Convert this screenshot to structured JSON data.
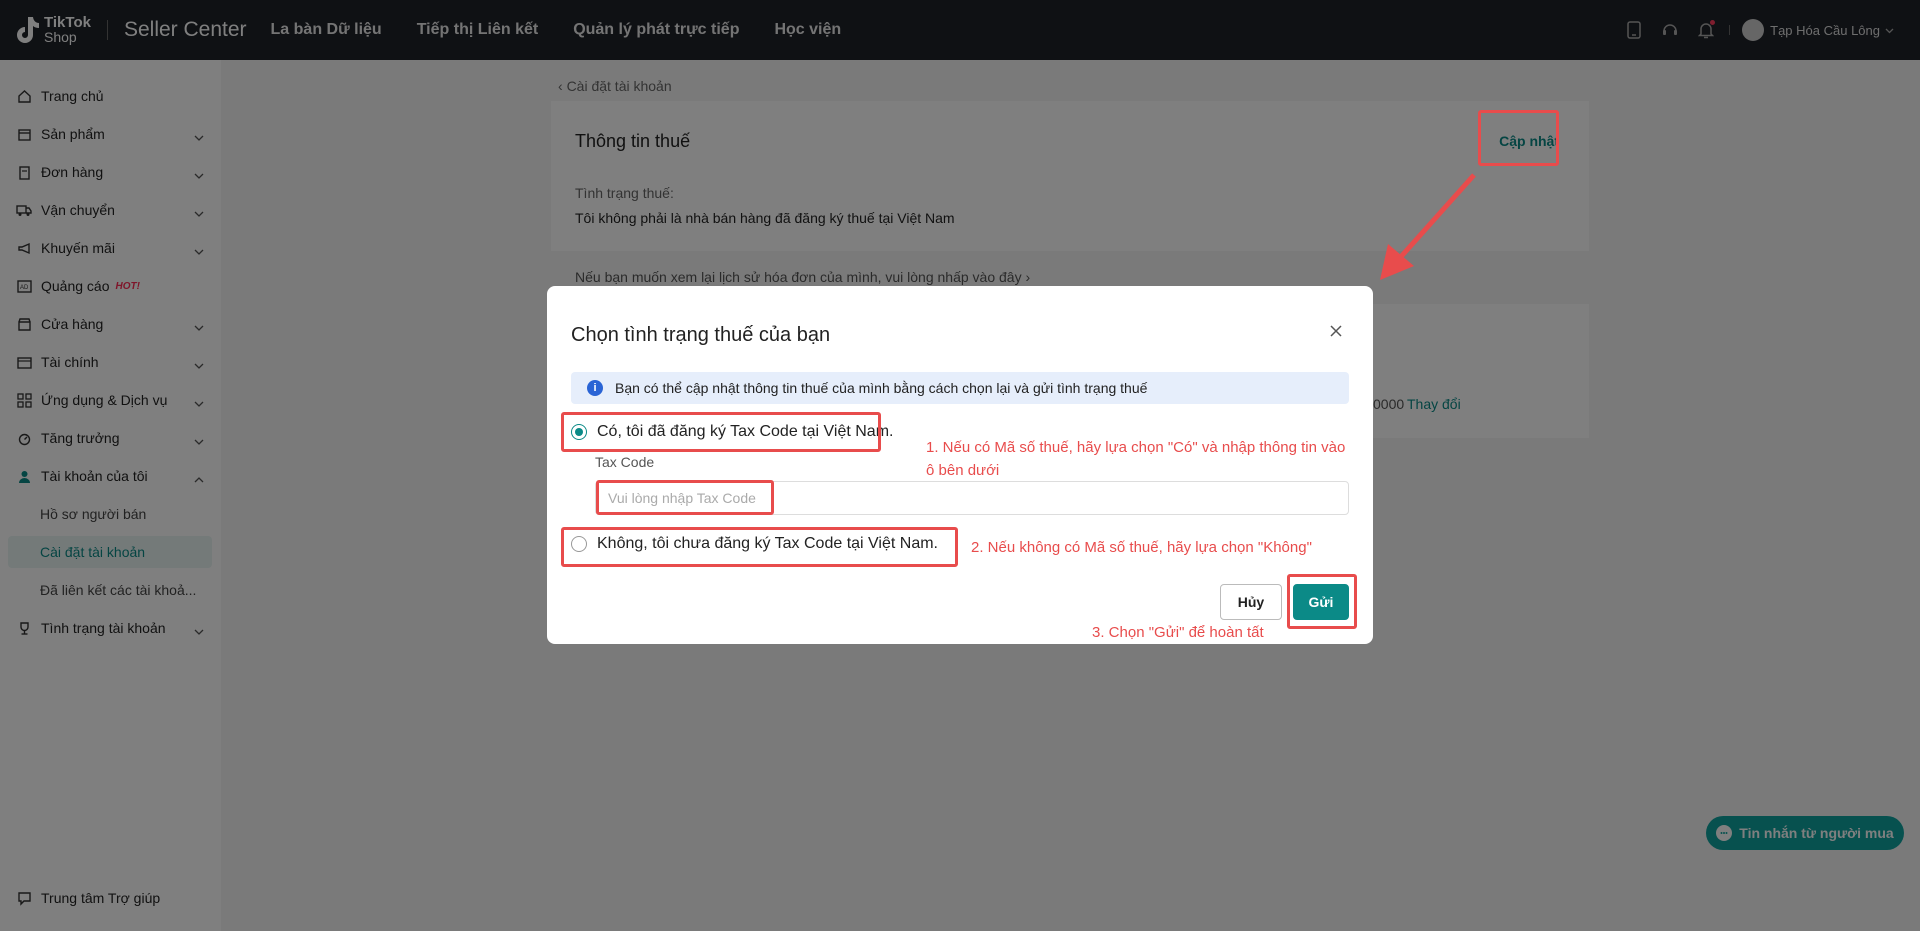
{
  "header": {
    "brand": "TikTok",
    "brand_sub": "Shop",
    "title": "Seller Center",
    "nav": [
      "La bàn Dữ liệu",
      "Tiếp thị Liên kết",
      "Quản lý phát trực tiếp",
      "Học viện"
    ],
    "user_name": "Tạp Hóa Cầu Lông"
  },
  "sidebar": {
    "items": [
      {
        "label": "Trang chủ",
        "icon": "home-icon"
      },
      {
        "label": "Sản phẩm",
        "icon": "box-icon"
      },
      {
        "label": "Đơn hàng",
        "icon": "clipboard-icon"
      },
      {
        "label": "Vận chuyển",
        "icon": "truck-icon"
      },
      {
        "label": "Khuyến mãi",
        "icon": "megaphone-icon"
      },
      {
        "label": "Quảng cáo",
        "icon": "ads-icon",
        "badge": "HOT!"
      },
      {
        "label": "Cửa hàng",
        "icon": "store-icon"
      },
      {
        "label": "Tài chính",
        "icon": "wallet-icon"
      },
      {
        "label": "Ứng dụng & Dịch vụ",
        "icon": "apps-icon"
      },
      {
        "label": "Tăng trưởng",
        "icon": "growth-icon"
      },
      {
        "label": "Tài khoản của tôi",
        "icon": "user-icon"
      },
      {
        "label": "Hồ sơ người bán"
      },
      {
        "label": "Cài đặt tài khoản"
      },
      {
        "label": "Đã liên kết các tài khoả..."
      },
      {
        "label": "Tình trạng tài khoản",
        "icon": "trophy-icon"
      }
    ],
    "help": "Trung tâm Trợ giúp"
  },
  "page": {
    "back_label": "Cài đặt tài khoản",
    "tax_card_title": "Thông tin thuế",
    "update_label": "Cập nhật",
    "tax_status_label": "Tình trạng thuế:",
    "tax_status_value": "Tôi không phải là nhà bán hàng đã đăng ký thuế tại Việt Nam",
    "history_link": "Nếu bạn muốn xem lại lịch sử hóa đơn của mình, vui lòng nhấp vào đây",
    "phone_tail": "0000",
    "change_label": "Thay đổi",
    "chat_label": "Tin nhắn từ người mua"
  },
  "modal": {
    "title": "Chọn tình trạng thuế của bạn",
    "info": "Bạn có thể cập nhật thông tin thuế của mình bằng cách chọn lại và gửi tình trạng thuế",
    "option_yes": "Có, tôi đã đăng ký Tax Code tại Việt Nam.",
    "option_no": "Không, tôi chưa đăng ký Tax Code tại Việt Nam.",
    "selected": "yes",
    "field_label": "Tax Code",
    "field_placeholder": "Vui lòng nhập Tax Code",
    "field_value": "",
    "cancel": "Hủy",
    "submit": "Gửi"
  },
  "annotations": {
    "step1": "1. Nếu có Mã số thuế, hãy lựa chọn \"Có\" và nhập thông tin vào ô bên dưới",
    "step2": "2. Nếu không có Mã số thuế, hãy lựa chọn \"Không\"",
    "step3": "3. Chọn \"Gửi\" để hoàn tất",
    "color": "#e84c4c"
  },
  "colors": {
    "accent": "#0b8a87",
    "topbar": "#1f2229",
    "info_bg": "#e6eefb"
  }
}
